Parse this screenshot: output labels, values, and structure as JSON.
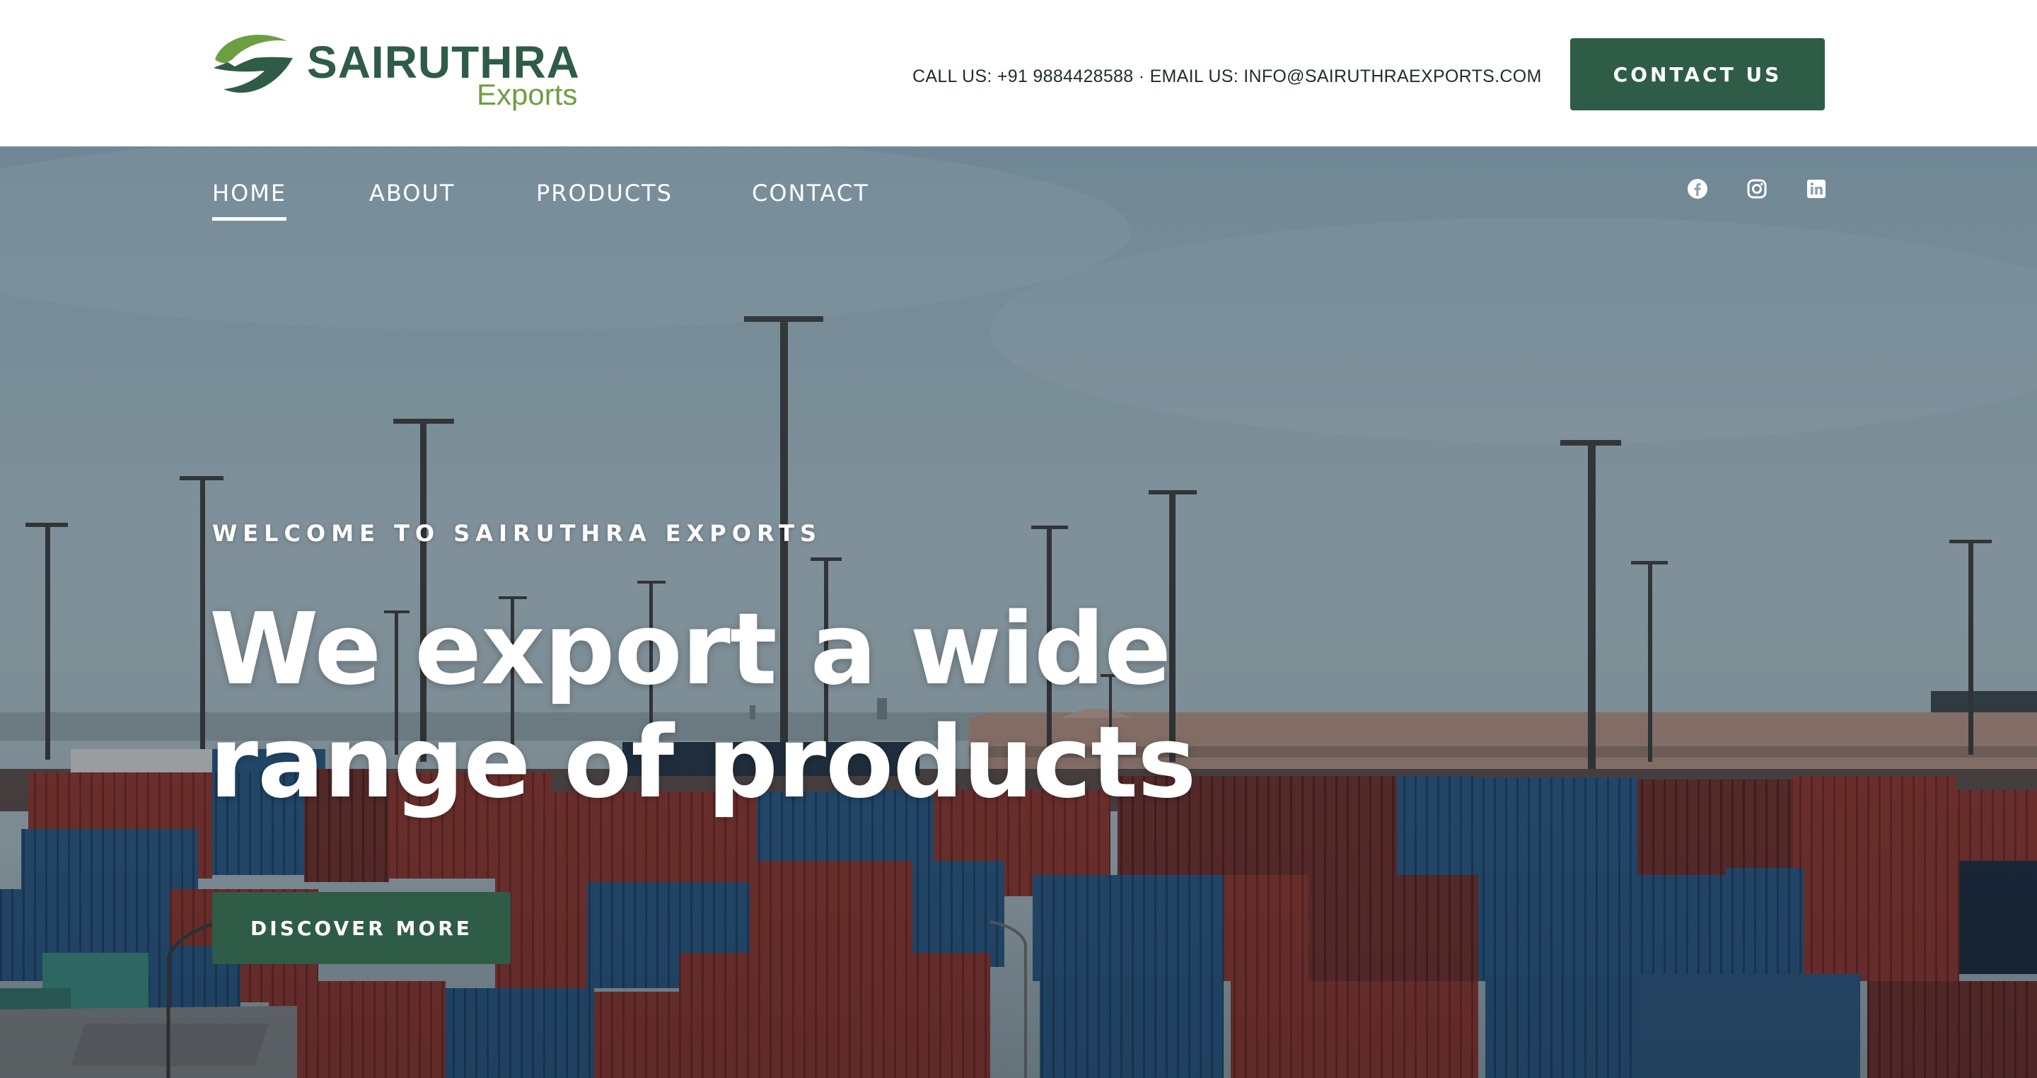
{
  "header": {
    "logo_name": "SAIRUTHRA",
    "logo_sub": "Exports",
    "contact_line": "CALL US: +91 9884428588 · EMAIL US: INFO@SAIRUTHRAEXPORTS.COM",
    "contact_button": "CONTACT US"
  },
  "nav": {
    "items": [
      {
        "label": "HOME",
        "active": true
      },
      {
        "label": "ABOUT",
        "active": false
      },
      {
        "label": "PRODUCTS",
        "active": false
      },
      {
        "label": "CONTACT",
        "active": false
      }
    ]
  },
  "social": {
    "icons": [
      "facebook-icon",
      "instagram-icon",
      "linkedin-icon"
    ]
  },
  "hero": {
    "eyebrow": "WELCOME TO SAIRUTHRA EXPORTS",
    "headline_line1": "We export a wide",
    "headline_line2": "range of products",
    "cta": "DISCOVER MORE",
    "photo_subject": "container-port-icon"
  },
  "colors": {
    "brand_green": "#2f5c46",
    "brand_light_green": "#6e9e42",
    "text_dark": "#1f2d28",
    "sky": "#8ea6b3",
    "container_red": "#8a3a36",
    "container_blue": "#2b5a86"
  }
}
